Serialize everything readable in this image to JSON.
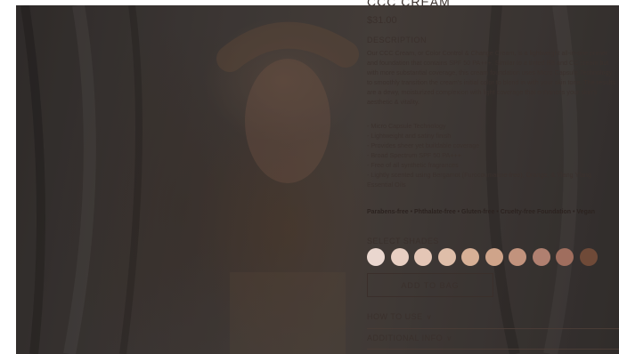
{
  "product": {
    "title": "CCC CREAM",
    "price": "$31.00"
  },
  "description": {
    "heading": "DESCRIPTION",
    "text": "Our CCC Cream, or Color Control & Change Cream, is a lightweight all-in-one primer and foundation that contains SPF 50 PA+++. Similar to a tinted BB and CC cream but with more substantial coverage, this cream foundation uses Micro Capsule Technology to smoothly transition the cream's initial color to blend in with your skin tone. The results are a dewy, moisturized complexion with light coverage that enhances your skin's aesthetic & vitality.",
    "features": [
      "Micro Capsule Technology",
      "Lightweight and satiny finish",
      "Provides sheer yet buildable coverage",
      "Broad Spectrum SPF 50 PA+++",
      "Free of all synthetic fragrances",
      "Lightly scented using Bergamot (Furocoumarine-free), Orange, & Ylang Ylang Essential Oils"
    ],
    "badges": "Parabens-free • Phthalate-free • Gluten-free • Cruelty-free Foundation • Vegan"
  },
  "shades": {
    "heading": "SELECT SHADES",
    "colors": [
      "#ead7cf",
      "#e8cfc2",
      "#e4c6b6",
      "#dfbea9",
      "#d7b096",
      "#cfa48a",
      "#c2937d",
      "#b08070",
      "#a06e5e",
      "#6f4a38"
    ]
  },
  "actions": {
    "add_to_bag": "ADD TO BAG"
  },
  "accordions": {
    "how_to_use": "HOW TO USE",
    "additional_info": "ADDITIONAL INFO"
  }
}
